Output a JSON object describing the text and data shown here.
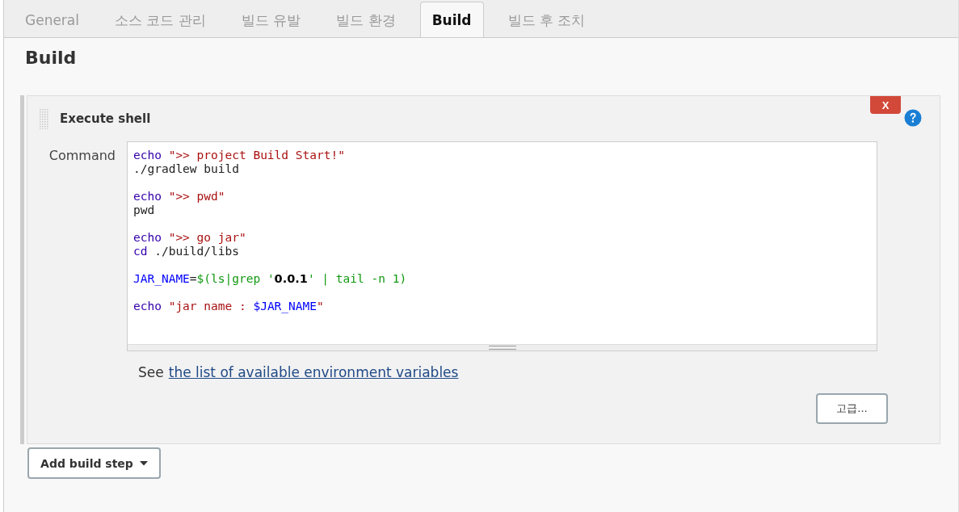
{
  "tabs": [
    {
      "label": "General",
      "selected": false
    },
    {
      "label": "소스 코드 관리",
      "selected": false
    },
    {
      "label": "빌드 유발",
      "selected": false
    },
    {
      "label": "빌드 환경",
      "selected": false
    },
    {
      "label": "Build",
      "selected": true
    },
    {
      "label": "빌드 후 조치",
      "selected": false
    }
  ],
  "section_title": "Build",
  "build_step": {
    "title": "Execute shell",
    "delete_button": "X",
    "command": {
      "label": "Command",
      "blocks": [
        [
          [
            {
              "kind": "keyword",
              "text": "echo"
            },
            {
              "kind": "string",
              "text": " \">> project Build Start!\""
            }
          ],
          [
            {
              "kind": "plain",
              "text": "./gradlew build"
            }
          ]
        ],
        [
          [
            {
              "kind": "keyword",
              "text": "echo"
            },
            {
              "kind": "string",
              "text": " \">> pwd\""
            }
          ],
          [
            {
              "kind": "plain",
              "text": "pwd"
            }
          ]
        ],
        [
          [
            {
              "kind": "keyword",
              "text": "echo"
            },
            {
              "kind": "string",
              "text": " \">> go jar\""
            }
          ],
          [
            {
              "kind": "keyword",
              "text": "cd"
            },
            {
              "kind": "plain",
              "text": " ./build/libs"
            }
          ]
        ],
        [
          [
            {
              "kind": "variable",
              "text": "JAR_NAME"
            },
            {
              "kind": "plain",
              "text": "="
            },
            {
              "kind": "subshell",
              "text": "$(ls|grep '"
            },
            {
              "kind": "bold",
              "text": "0.0.1"
            },
            {
              "kind": "subshell",
              "text": "' | tail -n 1)"
            }
          ]
        ],
        [
          [
            {
              "kind": "keyword",
              "text": "echo"
            },
            {
              "kind": "string",
              "text": " \"jar name : "
            },
            {
              "kind": "variable",
              "text": "$JAR_NAME"
            },
            {
              "kind": "string",
              "text": "\""
            }
          ]
        ]
      ]
    },
    "see_text": "See",
    "env_link": "the list of available environment variables",
    "advanced_button": "고급..."
  },
  "add_step_button": "Add build step"
}
